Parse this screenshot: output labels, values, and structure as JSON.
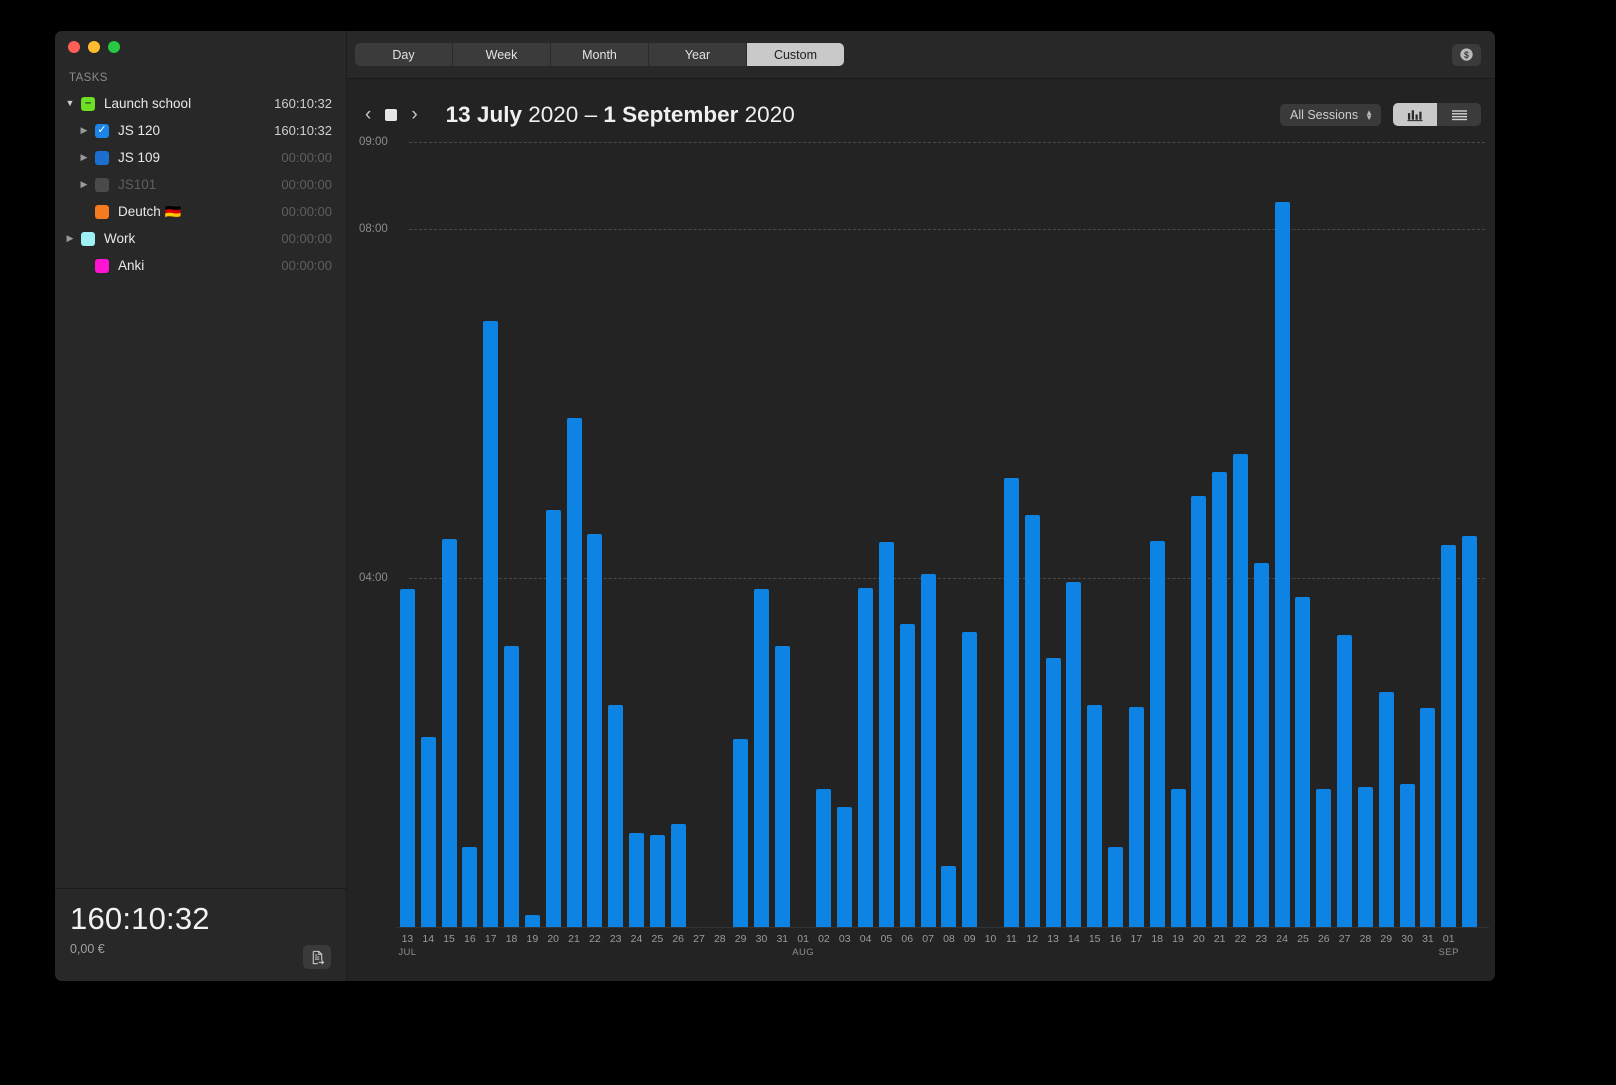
{
  "window": {
    "traffic_lights": [
      "close",
      "minimize",
      "zoom"
    ]
  },
  "sidebar": {
    "section_label": "TASKS",
    "items": [
      {
        "name": "Launch school",
        "time": "160:10:32",
        "color": "#6ee024",
        "indent": 0,
        "disclosure": "open",
        "checkbox": "minus",
        "dim": false
      },
      {
        "name": "JS 120",
        "time": "160:10:32",
        "color": "#1a84e8",
        "indent": 1,
        "disclosure": "closed",
        "checkbox": "check",
        "dim": false
      },
      {
        "name": "JS 109",
        "time": "00:00:00",
        "color": "#1a6fd0",
        "indent": 1,
        "disclosure": "closed",
        "checkbox": "none",
        "dim": false
      },
      {
        "name": "JS101",
        "time": "00:00:00",
        "color": "#4a4a4a",
        "indent": 1,
        "disclosure": "closed",
        "checkbox": "none",
        "dim": true
      },
      {
        "name": "Deutch 🇩🇪",
        "time": "00:00:00",
        "color": "#f47b20",
        "indent": 1,
        "disclosure": "none",
        "checkbox": "none",
        "dim": false
      },
      {
        "name": "Work",
        "time": "00:00:00",
        "color": "#9ff0f5",
        "indent": 0,
        "disclosure": "closed",
        "checkbox": "none",
        "dim": false
      },
      {
        "name": "Anki",
        "time": "00:00:00",
        "color": "#ff14d4",
        "indent": 1,
        "disclosure": "none",
        "checkbox": "none",
        "dim": false
      }
    ],
    "footer": {
      "total_time": "160:10:32",
      "total_money": "0,00 €",
      "export_icon": "export-document-icon"
    }
  },
  "toolbar": {
    "ranges": [
      {
        "label": "Day",
        "active": false
      },
      {
        "label": "Week",
        "active": false
      },
      {
        "label": "Month",
        "active": false
      },
      {
        "label": "Year",
        "active": false
      },
      {
        "label": "Custom",
        "active": true
      }
    ],
    "money_icon": "dollar-coin-icon"
  },
  "subbar": {
    "prev_icon": "chevron-left-icon",
    "stop_icon": "stop-square-icon",
    "next_icon": "chevron-right-icon",
    "range_start_day": "13 July",
    "range_start_year": "2020",
    "range_dash": "–",
    "range_end_day": "1 September",
    "range_end_year": "2020",
    "sessions_filter": "All Sessions",
    "sessions_stepper_icon": "stepper-updown-icon",
    "view_bar_icon": "bar-chart-icon",
    "view_list_icon": "list-view-icon",
    "view_active": "bar"
  },
  "chart_data": {
    "type": "bar",
    "title": "",
    "xlabel": "",
    "ylabel": "",
    "bar_color": "#0d84e3",
    "grid": true,
    "legend": null,
    "y_ticks": [
      "04:00",
      "08:00",
      "09:00"
    ],
    "y_tick_hours": [
      4,
      8,
      9
    ],
    "ylim": [
      0,
      9.4
    ],
    "y_unit": "hours",
    "categories": [
      "13 JUL",
      "14",
      "15",
      "16",
      "17",
      "18",
      "19",
      "20",
      "21",
      "22",
      "23",
      "24",
      "25",
      "26",
      "27",
      "28",
      "29",
      "30",
      "31",
      "01 AUG",
      "02",
      "03",
      "04",
      "05",
      "06",
      "07",
      "08",
      "09",
      "10",
      "11",
      "12",
      "13",
      "14",
      "15",
      "16",
      "17",
      "18",
      "19",
      "20",
      "21",
      "22",
      "23",
      "24",
      "25",
      "26",
      "27",
      "28",
      "29",
      "30",
      "31",
      "01 SEP"
    ],
    "month_markers": [
      {
        "index": 0,
        "label": "JUL"
      },
      {
        "index": 19,
        "label": "AUG"
      },
      {
        "index": 50,
        "label": "SEP"
      }
    ],
    "values": [
      3.88,
      2.18,
      4.45,
      0.92,
      6.95,
      3.22,
      0.14,
      4.78,
      5.84,
      4.51,
      2.55,
      1.08,
      1.05,
      1.18,
      0,
      0,
      2.16,
      3.88,
      3.22,
      0,
      1.58,
      1.38,
      3.89,
      4.42,
      3.47,
      4.05,
      0.7,
      3.38,
      0,
      5.15,
      4.72,
      3.08,
      3.96,
      2.55,
      0.92,
      2.52,
      4.43,
      1.58,
      4.94,
      5.22,
      5.42,
      4.18,
      8.32,
      3.78,
      1.58,
      3.35,
      1.6,
      2.7,
      1.64,
      2.51,
      4.38,
      4.48
    ]
  }
}
